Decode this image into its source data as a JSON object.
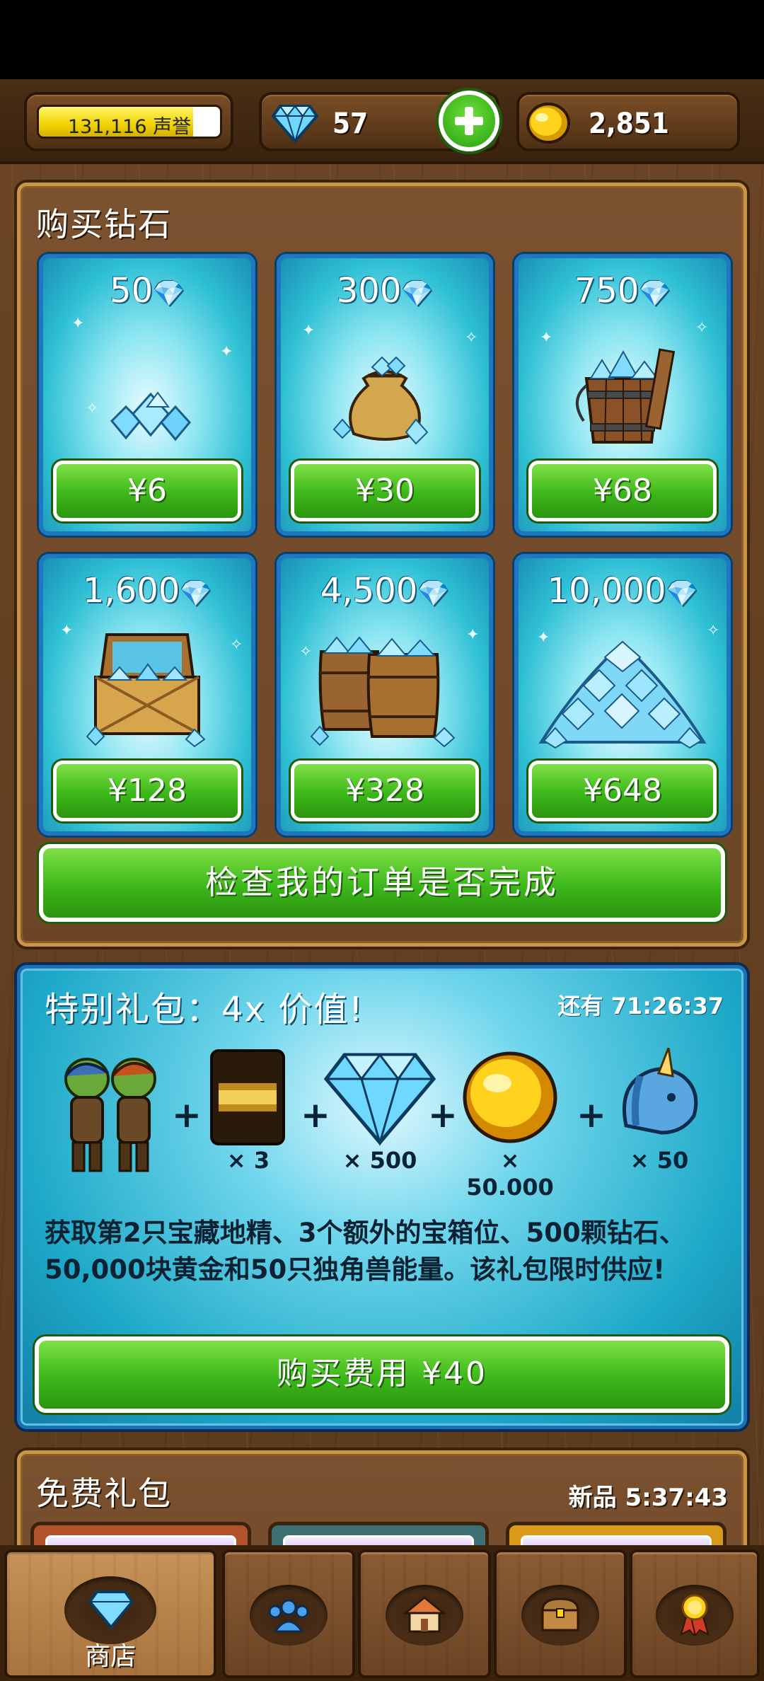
{
  "hud": {
    "reputation": "131,116 声誉",
    "reputation_progress": 0.85,
    "gems": "57",
    "gold": "2,851"
  },
  "buy_gems": {
    "title": "购买钻石",
    "packs": [
      {
        "amount": "50",
        "price": "¥6",
        "image": "small-gem-pile"
      },
      {
        "amount": "300",
        "price": "¥30",
        "image": "gem-sack"
      },
      {
        "amount": "750",
        "price": "¥68",
        "image": "gem-bucket"
      },
      {
        "amount": "1,600",
        "price": "¥128",
        "image": "gem-chest"
      },
      {
        "amount": "4,500",
        "price": "¥328",
        "image": "gem-barrels"
      },
      {
        "amount": "10,000",
        "price": "¥648",
        "image": "gem-mountain"
      }
    ],
    "check_orders_label": "检查我的订单是否完成"
  },
  "special": {
    "title": "特别礼包：4x 价值!",
    "timer": "还有 71:26:37",
    "items": [
      {
        "icon": "goblins-icon",
        "qty": ""
      },
      {
        "icon": "chest-slot-card-icon",
        "qty": "× 3"
      },
      {
        "icon": "diamond-icon",
        "qty": "× 500"
      },
      {
        "icon": "gold-coin-icon",
        "qty": "× 50.000"
      },
      {
        "icon": "unicorn-icon",
        "qty": "× 50"
      }
    ],
    "description": "获取第2只宝藏地精、3个额外的宝箱位、500颗钻石、50,000块黄金和50只独角兽能量。该礼包限时供应!",
    "buy_label": "购买费用 ¥40"
  },
  "free": {
    "title": "免费礼包",
    "timer": "新品 5:37:43"
  },
  "nav": {
    "tabs": [
      {
        "label": "商店",
        "icon": "shop-diamond-icon",
        "active": true
      },
      {
        "label": "",
        "icon": "friends-icon",
        "active": false
      },
      {
        "label": "",
        "icon": "village-icon",
        "active": false
      },
      {
        "label": "",
        "icon": "treasure-chest-icon",
        "active": false
      },
      {
        "label": "",
        "icon": "achievement-medal-icon",
        "active": false
      }
    ]
  },
  "colors": {
    "accent_green": "#3cb81a",
    "card_cyan": "#2dbfd4",
    "wood_brown": "#6b4526"
  }
}
